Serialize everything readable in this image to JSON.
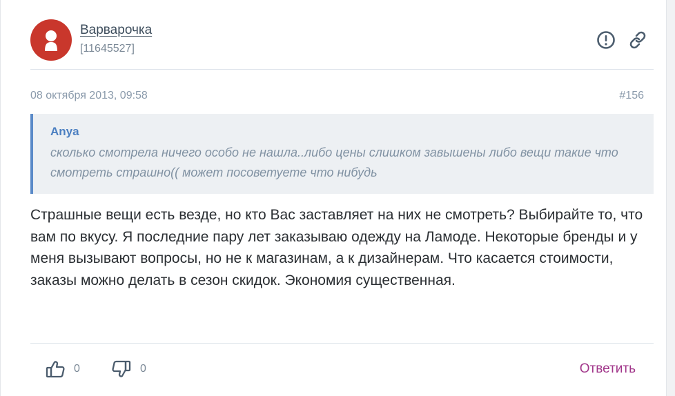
{
  "post": {
    "author": {
      "name": "Варварочка",
      "id": "[11645527]"
    },
    "date": "08 октября 2013, 09:58",
    "number": "#156",
    "quote": {
      "author": "Anya",
      "text": "сколько смотрела ничего особо не нашла..либо цены слишком завышены либо вещи такие что смотреть страшно(( может посоветуете что нибудь"
    },
    "body": "Страшные вещи есть везде, но кто Вас заставляет на них не смотреть? Выбирайте то, что вам по вкусу. Я последние пару лет заказываю одежду на Ламоде. Некоторые бренды и у меня вызывают вопросы, но не к магазинам, а к дизайнерам. Что касается стоимости, заказы можно делать в сезон скидок. Экономия существенная.",
    "likes": "0",
    "dislikes": "0",
    "reply_label": "Ответить"
  },
  "icons": {
    "avatar": "user-silhouette-icon",
    "report": "exclamation-circle-icon",
    "link": "chain-link-icon",
    "like": "thumbs-up-icon",
    "dislike": "thumbs-down-icon"
  },
  "colors": {
    "avatar_bg": "#c9372c",
    "quote_bar": "#5a8ac8",
    "quote_author": "#4b7fc1",
    "reply": "#a1368a"
  }
}
